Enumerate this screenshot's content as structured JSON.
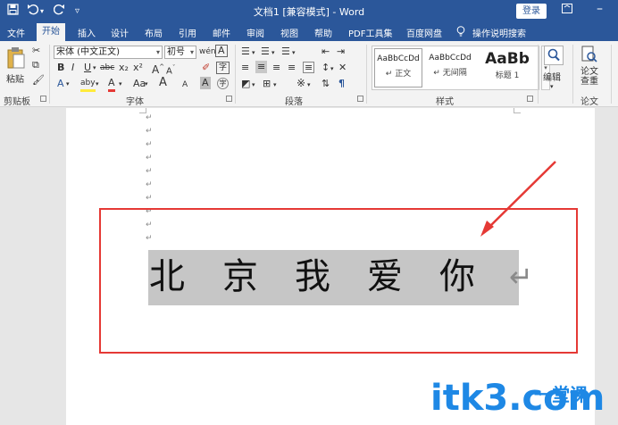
{
  "titlebar": {
    "title": "文档1 [兼容模式] - Word",
    "login_label": "登录",
    "qa_icons": [
      "save-icon",
      "undo-icon",
      "redo-icon",
      "customize-icon"
    ]
  },
  "tabs": [
    "文件",
    "开始",
    "插入",
    "设计",
    "布局",
    "引用",
    "邮件",
    "审阅",
    "视图",
    "帮助",
    "PDF工具集",
    "百度网盘",
    "操作说明搜索"
  ],
  "active_tab": "开始",
  "ribbon": {
    "clipboard": {
      "paste_label": "粘贴",
      "group_label": "剪贴板"
    },
    "font": {
      "font_name": "宋体 (中文正文)",
      "font_size": "初号",
      "group_label": "字体",
      "wen_label": "wén",
      "A_label": "A",
      "buttons": [
        "B",
        "I",
        "U",
        "abc",
        "x₂",
        "x²",
        "A",
        "aby",
        "A",
        "Aa",
        "A",
        "A",
        "A"
      ]
    },
    "paragraph": {
      "group_label": "段落"
    },
    "styles": {
      "group_label": "样式",
      "items": [
        {
          "preview": "AaBbCcDd",
          "name": "↵ 正文"
        },
        {
          "preview": "AaBbCcDd",
          "name": "↵ 无间隔"
        },
        {
          "preview": "AaBb",
          "name": "标题 1"
        }
      ]
    },
    "editing": {
      "label": "编辑"
    },
    "paper": {
      "label": "论文\n查重",
      "group_label": "论文"
    }
  },
  "document": {
    "empty_paragraph_mark": "↵",
    "empty_lines": 10,
    "text": [
      "北",
      "京",
      "我",
      "爱",
      "你"
    ],
    "end_mark": "↵"
  },
  "watermark": {
    "text": "itk3.com",
    "sub": "一堂课"
  },
  "colors": {
    "brand": "#2b579a",
    "highlight": "#c6c6c6",
    "annotation": "#e53935",
    "watermark": "#1e88e5"
  }
}
